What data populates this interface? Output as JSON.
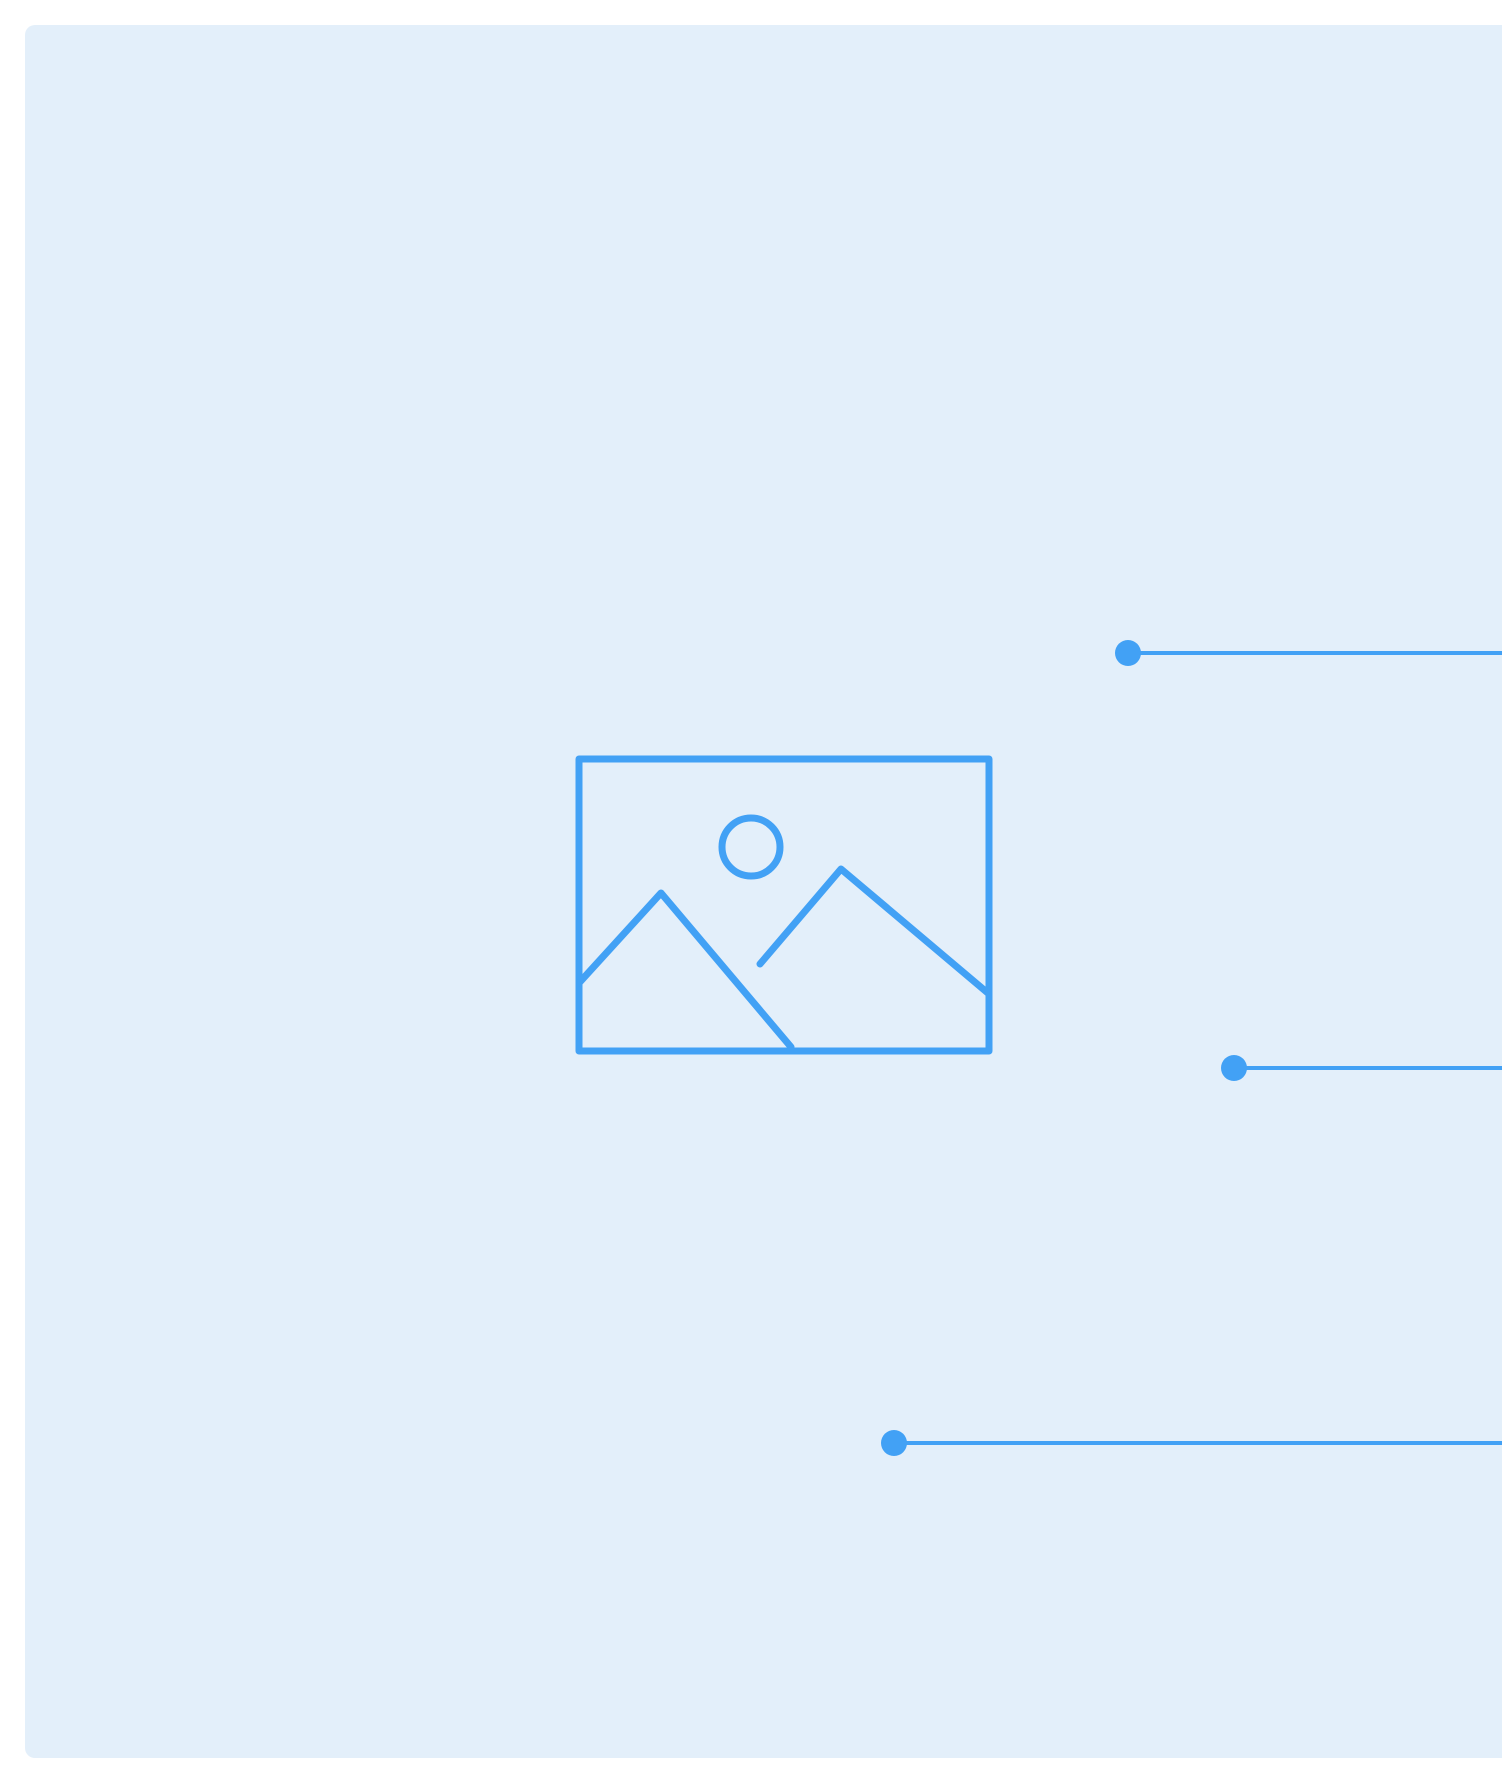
{
  "placeholder": {
    "icon": "image-placeholder-icon",
    "accent_color": "#42a1f5",
    "background_color": "#e3effa"
  },
  "callouts": [
    {
      "name": "callout-line-1"
    },
    {
      "name": "callout-line-2"
    },
    {
      "name": "callout-line-3"
    }
  ]
}
